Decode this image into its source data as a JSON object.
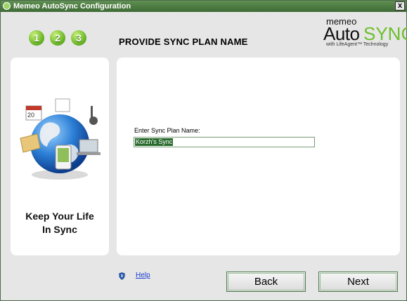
{
  "window": {
    "title": "Memeo AutoSync Configuration",
    "close_label": "x"
  },
  "steps": [
    "1",
    "2",
    "3"
  ],
  "page_heading": "PROVIDE SYNC PLAN NAME",
  "logo": {
    "memeo": "memeo",
    "auto": "Auto",
    "sync": "SYNC",
    "tagline": "with LifeAgent™ Technology"
  },
  "sidebar": {
    "tagline_line1": "Keep Your Life",
    "tagline_line2": "In Sync"
  },
  "form": {
    "label": "Enter Sync Plan Name:",
    "value": "Korzh's Sync"
  },
  "footer": {
    "help_label": "Help",
    "back_label": "Back",
    "next_label": "Next"
  },
  "colors": {
    "title_bar": "#4f7d44",
    "accent_green": "#6cbf2c",
    "selection": "#2a6b2e",
    "link": "#1a3bd1"
  }
}
